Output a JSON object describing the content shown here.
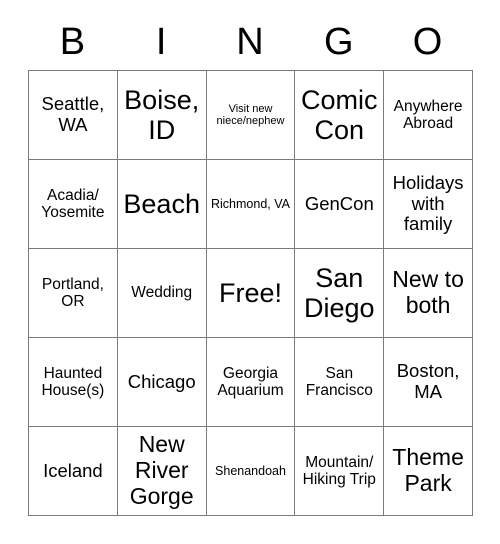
{
  "card": {
    "header_letters": [
      "B",
      "I",
      "N",
      "G",
      "O"
    ],
    "columns": 5,
    "rows": 5,
    "border_color": "#7a7a7a",
    "text_color": "#000000",
    "background_color": "#ffffff",
    "cells": [
      [
        {
          "text": "Seattle, WA",
          "size": "sz-l"
        },
        {
          "text": "Boise, ID",
          "size": "sz-xxl"
        },
        {
          "text": "Visit new niece/nephew",
          "size": "sz-xs"
        },
        {
          "text": "Comic Con",
          "size": "sz-xxl"
        },
        {
          "text": "Anywhere Abroad",
          "size": "sz-m"
        }
      ],
      [
        {
          "text": "Acadia/ Yosemite",
          "size": "sz-m"
        },
        {
          "text": "Beach",
          "size": "sz-xxl"
        },
        {
          "text": "Richmond, VA",
          "size": "sz-s"
        },
        {
          "text": "GenCon",
          "size": "sz-l"
        },
        {
          "text": "Holidays with family",
          "size": "sz-l"
        }
      ],
      [
        {
          "text": "Portland, OR",
          "size": "sz-m"
        },
        {
          "text": "Wedding",
          "size": "sz-m"
        },
        {
          "text": "Free!",
          "size": "sz-xxl"
        },
        {
          "text": "San Diego",
          "size": "sz-xxl"
        },
        {
          "text": "New to both",
          "size": "sz-xl"
        }
      ],
      [
        {
          "text": "Haunted House(s)",
          "size": "sz-m"
        },
        {
          "text": "Chicago",
          "size": "sz-l"
        },
        {
          "text": "Georgia Aquarium",
          "size": "sz-m"
        },
        {
          "text": "San Francisco",
          "size": "sz-m"
        },
        {
          "text": "Boston, MA",
          "size": "sz-l"
        }
      ],
      [
        {
          "text": "Iceland",
          "size": "sz-l"
        },
        {
          "text": "New River Gorge",
          "size": "sz-xl"
        },
        {
          "text": "Shenandoah",
          "size": "sz-s"
        },
        {
          "text": "Mountain/ Hiking Trip",
          "size": "sz-m"
        },
        {
          "text": "Theme Park",
          "size": "sz-xl"
        }
      ]
    ]
  }
}
